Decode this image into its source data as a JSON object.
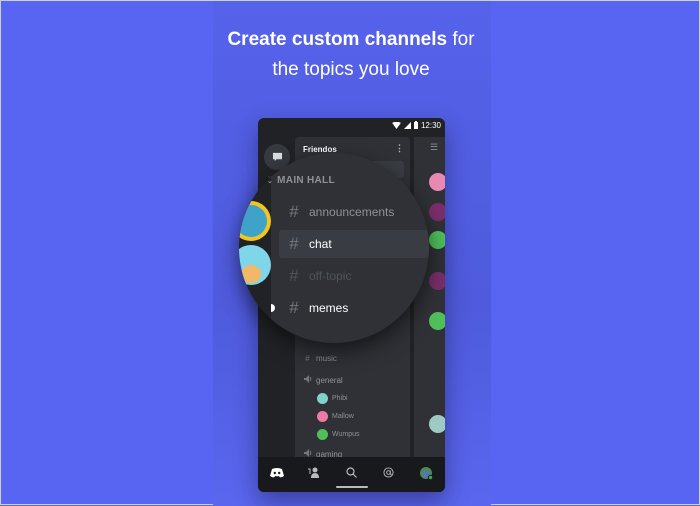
{
  "headline": {
    "bold": "Create custom channels",
    "rest_line1": " for",
    "line2": "the topics you love"
  },
  "colors": {
    "background": "#5865f2",
    "phone_bg": "#202225",
    "panel_bg": "#2f3136",
    "selected_bg": "#393c43",
    "online_status": "#3ba55d"
  },
  "status_bar": {
    "time": "12:30",
    "icons": [
      "wifi-icon",
      "signal-icon",
      "battery-icon"
    ]
  },
  "server": {
    "name": "Friendos",
    "menu_icon": "kebab-menu-icon"
  },
  "magnified": {
    "category": "MAIN HALL",
    "channels": [
      {
        "name": "announcements",
        "state": "normal"
      },
      {
        "name": "chat",
        "state": "selected"
      },
      {
        "name": "off-topic",
        "state": "muted"
      },
      {
        "name": "memes",
        "state": "unread"
      }
    ]
  },
  "channels_below": [
    {
      "type": "text",
      "name": "music"
    },
    {
      "type": "voice",
      "name": "general",
      "members": [
        "Phibi",
        "Mallow",
        "Wumpus"
      ]
    },
    {
      "type": "voice",
      "name": "gaming"
    }
  ],
  "bottom_nav": [
    {
      "name": "home",
      "icon": "discord-logo-icon"
    },
    {
      "name": "friends",
      "icon": "friends-icon"
    },
    {
      "name": "search",
      "icon": "search-icon"
    },
    {
      "name": "mentions",
      "icon": "at-icon"
    },
    {
      "name": "profile",
      "icon": "avatar-icon"
    }
  ]
}
